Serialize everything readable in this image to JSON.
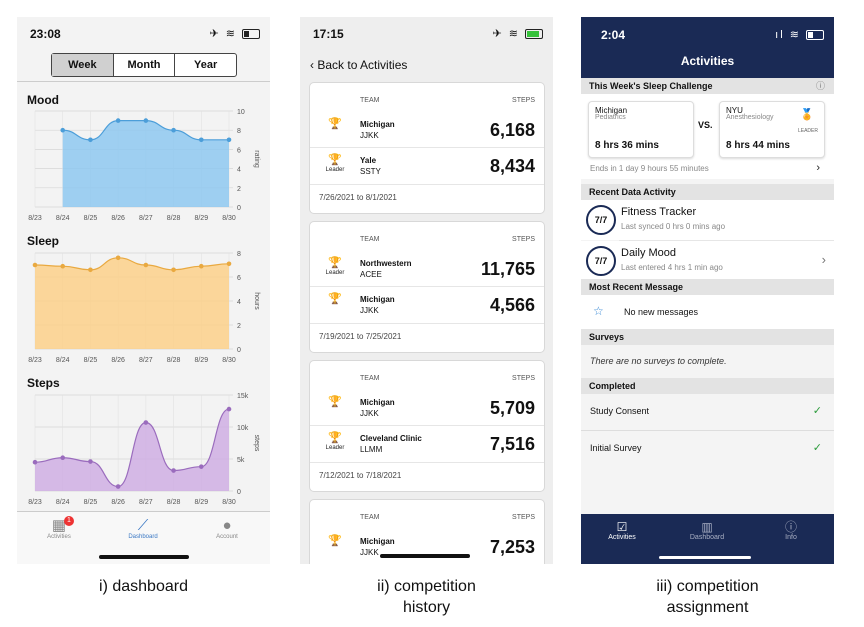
{
  "dashboard": {
    "status_time": "23:08",
    "segments": [
      "Week",
      "Month",
      "Year"
    ],
    "active_segment": "Week",
    "charts": {
      "mood": {
        "title": "Mood",
        "ylabel": "rating",
        "color": "#8ec8f0",
        "stroke": "#4c9ed9",
        "yticks": [
          "10",
          "8",
          "6",
          "4",
          "2",
          "0"
        ],
        "x": [
          "8/23",
          "8/24",
          "8/25",
          "8/26",
          "8/27",
          "8/28",
          "8/29",
          "8/30"
        ],
        "values": [
          null,
          8,
          7,
          9,
          9,
          8,
          7,
          7
        ],
        "ylim": [
          0,
          10
        ]
      },
      "sleep": {
        "title": "Sleep",
        "ylabel": "hours",
        "color": "#fbd089",
        "stroke": "#e9a940",
        "yticks": [
          "8",
          "6",
          "4",
          "2",
          "0"
        ],
        "x": [
          "8/23",
          "8/24",
          "8/25",
          "8/26",
          "8/27",
          "8/28",
          "8/29",
          "8/30"
        ],
        "values": [
          7,
          6.9,
          6.6,
          7.6,
          7,
          6.6,
          6.9,
          7.1
        ],
        "ylim": [
          0,
          8
        ]
      },
      "steps": {
        "title": "Steps",
        "ylabel": "steps",
        "color": "#cfaee3",
        "stroke": "#9a6cbd",
        "yticks": [
          "15k",
          "10k",
          "5k",
          "0"
        ],
        "x": [
          "8/23",
          "8/24",
          "8/25",
          "8/26",
          "8/27",
          "8/28",
          "8/29",
          "8/30"
        ],
        "values": [
          4500,
          5200,
          4600,
          700,
          10700,
          3200,
          3800,
          12800
        ],
        "ylim": [
          0,
          15000
        ]
      }
    },
    "tabs": [
      {
        "label": "Activities",
        "icon": "calendar-icon",
        "badge": "1"
      },
      {
        "label": "Dashboard",
        "icon": "chart-icon"
      },
      {
        "label": "Account",
        "icon": "person-icon"
      }
    ],
    "caption": "i) dashboard"
  },
  "history": {
    "status_time": "17:15",
    "back_label": "Back to Activities",
    "team_header": "TEAM",
    "steps_header": "STEPS",
    "leader_label": "Leader",
    "cards": [
      {
        "rows": [
          {
            "team": "Michigan",
            "code": "JJKK",
            "steps": "6,168",
            "leader": false
          },
          {
            "team": "Yale",
            "code": "SSTY",
            "steps": "8,434",
            "leader": true
          }
        ],
        "dates": "7/26/2021 to 8/1/2021"
      },
      {
        "rows": [
          {
            "team": "Northwestern",
            "code": "ACEE",
            "steps": "11,765",
            "leader": true
          },
          {
            "team": "Michigan",
            "code": "JJKK",
            "steps": "4,566",
            "leader": false
          }
        ],
        "dates": "7/19/2021 to 7/25/2021"
      },
      {
        "rows": [
          {
            "team": "Michigan",
            "code": "JJKK",
            "steps": "5,709",
            "leader": false
          },
          {
            "team": "Cleveland Clinic",
            "code": "LLMM",
            "steps": "7,516",
            "leader": true
          }
        ],
        "dates": "7/12/2021 to 7/18/2021"
      },
      {
        "rows": [
          {
            "team": "Michigan",
            "code": "JJKK",
            "steps": "7,253",
            "leader": false
          }
        ],
        "dates": ""
      }
    ],
    "caption_line1": "ii) competition",
    "caption_line2": "history"
  },
  "assignment": {
    "status_time": "2:04",
    "title": "Activities",
    "sleep_challenge_header": "This Week's Sleep Challenge",
    "team_left": {
      "name": "Michigan",
      "sub": "Pediatrics",
      "hours": "8 hrs 36 mins"
    },
    "vs": "VS.",
    "team_right": {
      "name": "NYU",
      "sub": "Anesthesiology",
      "hours": "8 hrs 44 mins",
      "badge": "LEADER"
    },
    "ends_text": "Ends in 1 day 9 hours 55 minutes",
    "recent_header": "Recent Data Activity",
    "activities": [
      {
        "title": "Fitness Tracker",
        "sub": "Last synced 0 hrs 0 mins ago",
        "ring": "7/7"
      },
      {
        "title": "Daily Mood",
        "sub": "Last entered 4 hrs 1 min ago",
        "ring": "7/7"
      }
    ],
    "message_header": "Most Recent Message",
    "message_text": "No new messages",
    "surveys_header": "Surveys",
    "surveys_text": "There are no surveys to complete.",
    "completed_header": "Completed",
    "completed": [
      "Study Consent",
      "Initial Survey"
    ],
    "tabs": [
      {
        "label": "Activities",
        "icon": "checkbox-icon"
      },
      {
        "label": "Dashboard",
        "icon": "chart-icon"
      },
      {
        "label": "Info",
        "icon": "info-icon"
      }
    ],
    "caption_line1": "iii) competition",
    "caption_line2": "assignment"
  }
}
